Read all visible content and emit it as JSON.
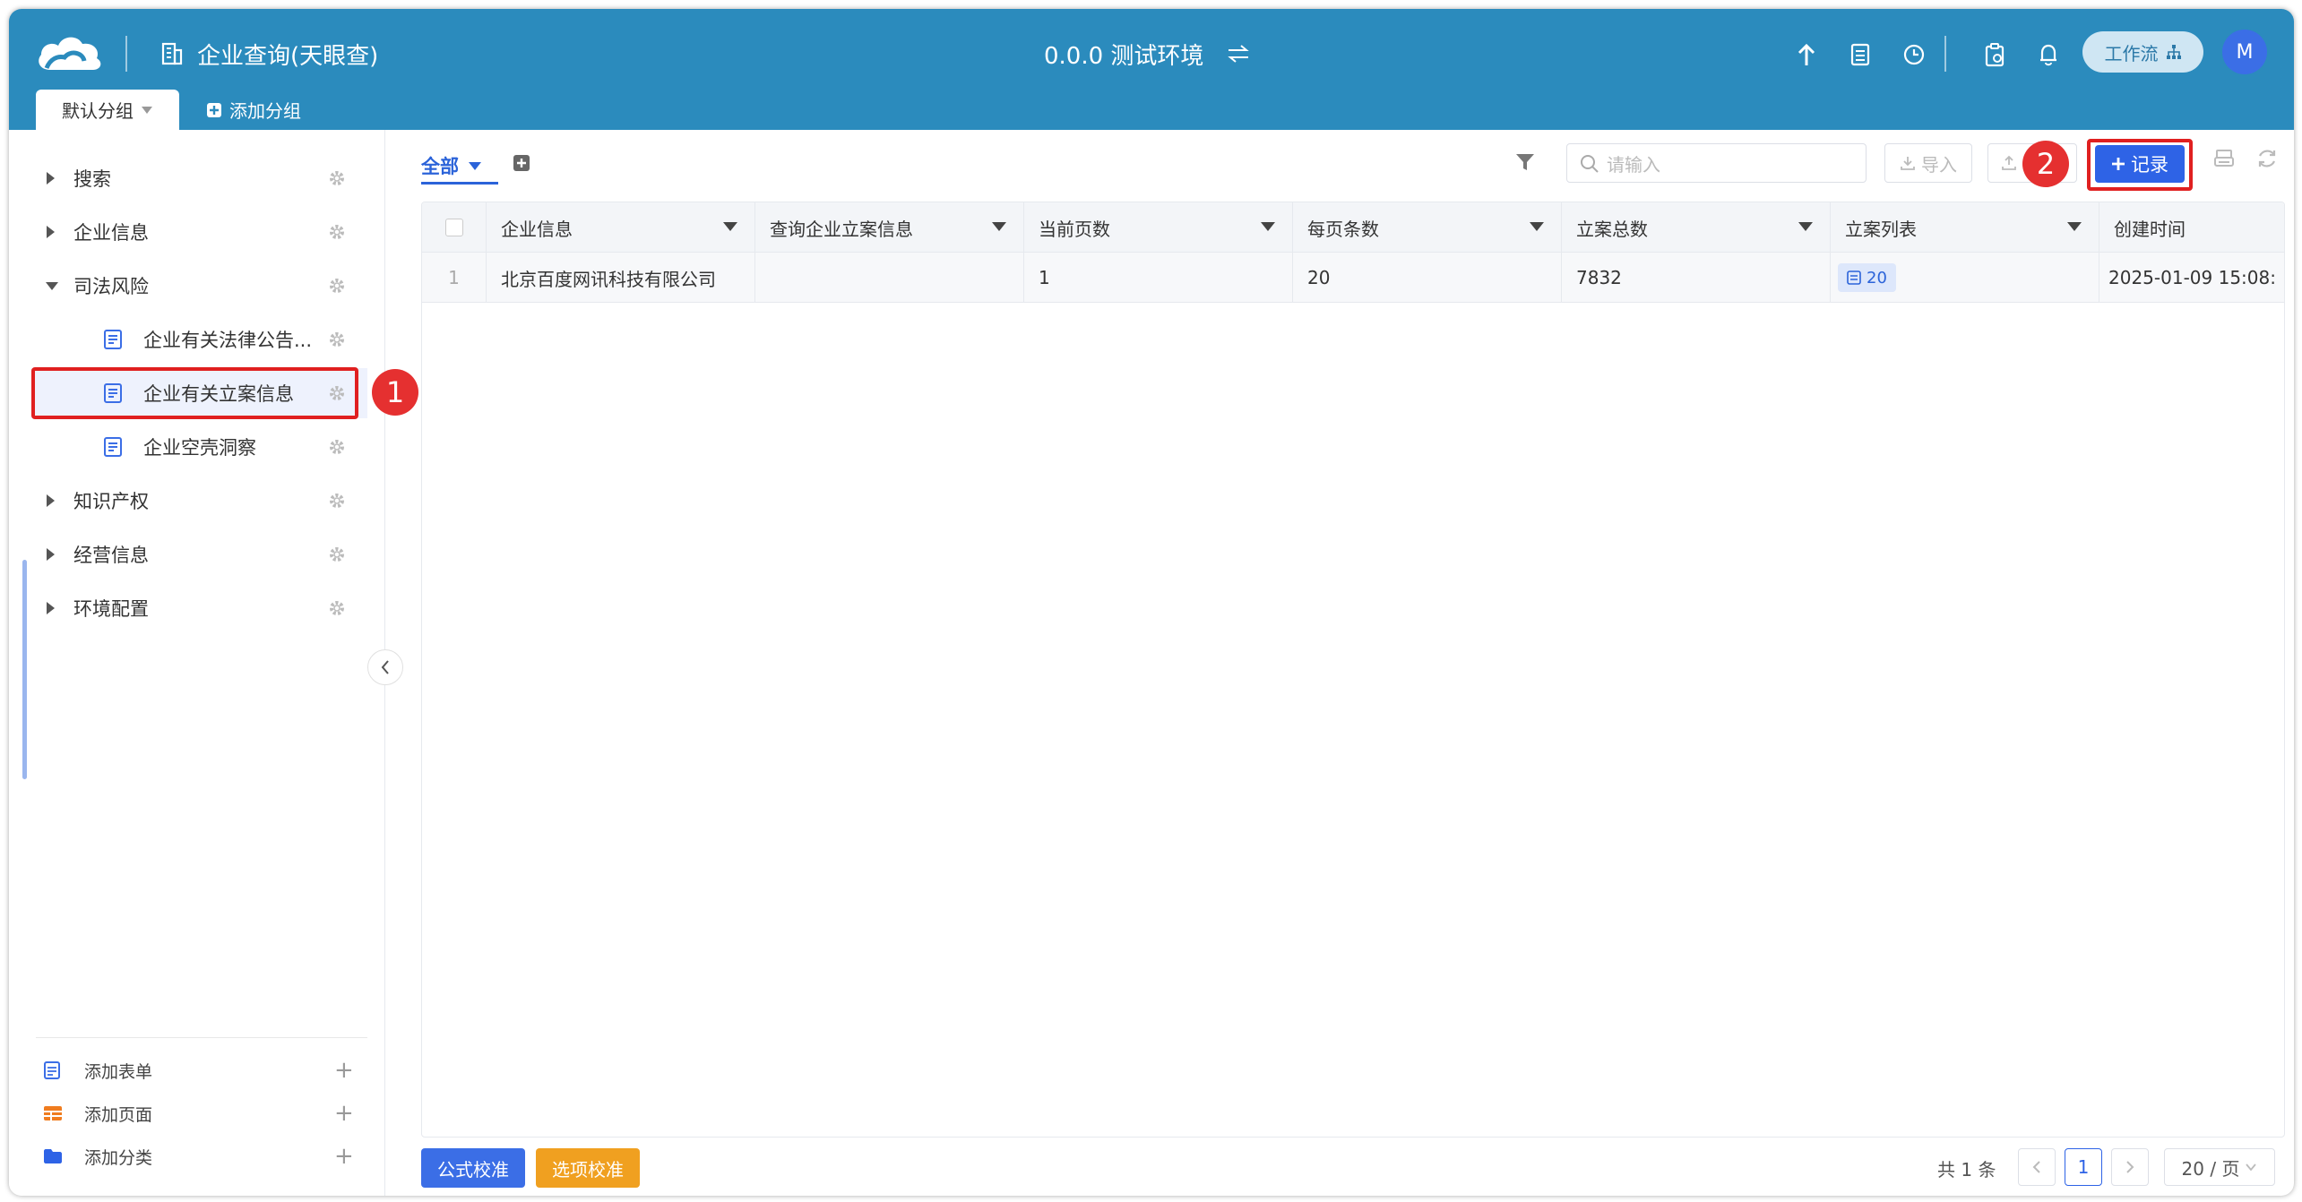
{
  "header": {
    "app_title": "企业查询(天眼查)",
    "environment": "0.0.0 测试环境",
    "workflow_label": "工作流",
    "avatar_initial": "M",
    "brand_color": "#2b8bbd"
  },
  "groups": {
    "active_tab": "默认分组",
    "add_group_label": "添加分组"
  },
  "sidebar": {
    "items": [
      {
        "label": "搜索"
      },
      {
        "label": "企业信息"
      },
      {
        "label": "司法风险"
      },
      {
        "label": "企业有关法律公告..."
      },
      {
        "label": "企业有关立案信息"
      },
      {
        "label": "企业空壳洞察"
      },
      {
        "label": "知识产权"
      },
      {
        "label": "经营信息"
      },
      {
        "label": "环境配置"
      }
    ],
    "bottom": {
      "add_form": "添加表单",
      "add_page": "添加页面",
      "add_category": "添加分类"
    }
  },
  "annotations": {
    "step1": "1",
    "step2": "2"
  },
  "toolbar": {
    "view_tab": "全部",
    "search_placeholder": "请输入",
    "import_label": "导入",
    "record_label": "记录"
  },
  "table": {
    "columns": [
      "企业信息",
      "查询企业立案信息",
      "当前页数",
      "每页条数",
      "立案总数",
      "立案列表",
      "创建时间"
    ],
    "rows": [
      {
        "index": "1",
        "company": "北京百度网讯科技有限公司",
        "query": "",
        "current_page": "1",
        "page_size": "20",
        "total": "7832",
        "list_count": "20",
        "created": "2025-01-09 15:08:"
      }
    ]
  },
  "footer": {
    "formula_check": "公式校准",
    "option_check": "选项校准",
    "total_text": "共 1 条",
    "current_page": "1",
    "page_size_label": "20 / 页"
  }
}
